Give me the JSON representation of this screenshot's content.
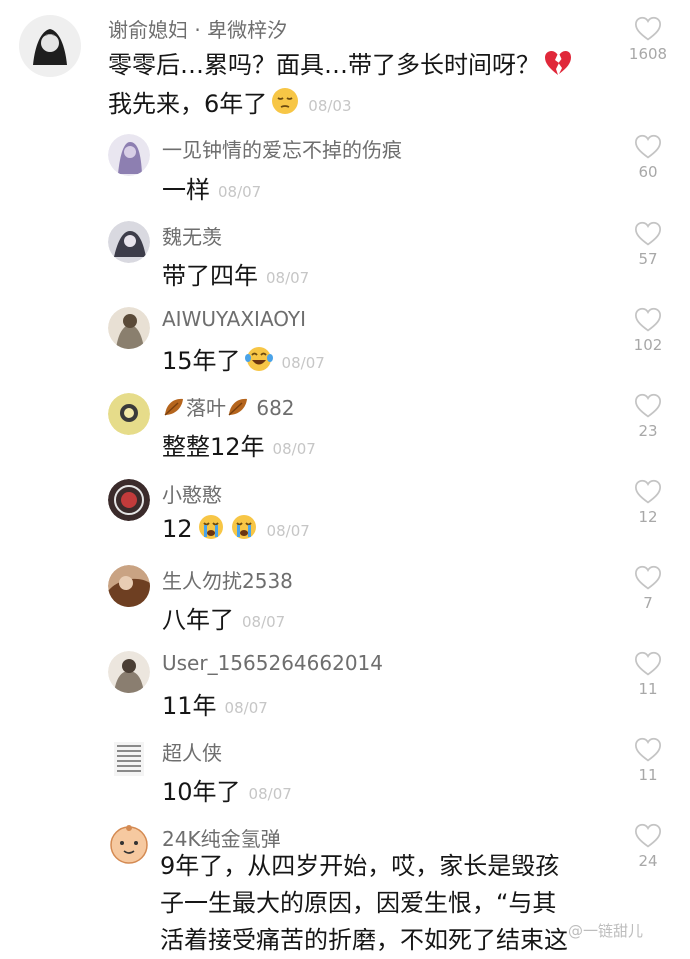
{
  "comments": [
    {
      "username": "谢俞媳妇 · 卑微梓汐",
      "line1": "零零后…累吗？面具…带了多长时间呀？",
      "line2": "我先来，6年了",
      "date": "08/03",
      "likes": "1608",
      "avatar_color": "#2a2a2a"
    },
    {
      "username": "一见钟情的爱忘不掉的伤痕",
      "text": "一样",
      "date": "08/07",
      "likes": "60",
      "avatar_color": "#8d7fb1"
    },
    {
      "username": "魏无羡",
      "text": "带了四年",
      "date": "08/07",
      "likes": "57",
      "avatar_color": "#4f4f5e"
    },
    {
      "username": "AIWUYAXIAOYI",
      "text": "15年了",
      "date": "08/07",
      "likes": "102",
      "avatar_color": "#a39686"
    },
    {
      "username": "落叶",
      "username_suffix": "682",
      "text": "整整12年",
      "date": "08/07",
      "likes": "23",
      "avatar_color": "#c9b34a"
    },
    {
      "username": "小憨憨",
      "text": "12",
      "date": "08/07",
      "likes": "12",
      "avatar_color": "#5a3b3b"
    },
    {
      "username": "生人勿扰2538",
      "text": "八年了",
      "date": "08/07",
      "likes": "7",
      "avatar_color": "#8c5a3c"
    },
    {
      "username": "User_1565264662014",
      "text": "11年",
      "date": "08/07",
      "likes": "11",
      "avatar_color": "#9a8e80"
    },
    {
      "username": "超人侠",
      "text": "10年了",
      "date": "08/07",
      "likes": "11",
      "avatar_color": "#7c7c7c"
    },
    {
      "username": "24K纯金氢弹",
      "lines": [
        "9年了，从四岁开始，哎，家长是毁孩",
        "子一生最大的原因，因爱生恨，“与其",
        "活着接受痛苦的折磨，不如死了结束这"
      ],
      "likes": "24",
      "avatar_color": "#f0b184"
    }
  ],
  "watermark": "@一链甜儿",
  "icons": {
    "like": "heart-outline-icon",
    "broken_heart": "broken-heart-emoji",
    "pensive": "pensive-emoji",
    "laugh": "tears-of-joy-emoji",
    "cry": "crying-emoji",
    "leaf": "fallen-leaf-icon"
  }
}
